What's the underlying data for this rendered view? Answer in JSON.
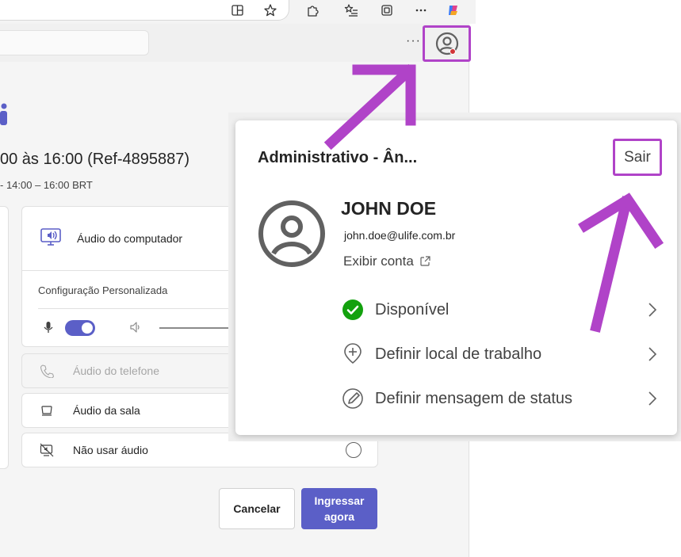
{
  "browser": {
    "icons": [
      "grid-split-icon",
      "favorite-star-icon",
      "extensions-icon",
      "favorites-list-icon",
      "collections-icon",
      "more-icon",
      "copilot-icon"
    ]
  },
  "app": {
    "more_label": "···",
    "meeting": {
      "title": "00 às 16:00 (Ref-4895887)",
      "time": "-  14:00  –  16:00 BRT"
    },
    "audio": {
      "computer_label": "Áudio do computador",
      "config_label": "Configuração Personalizada",
      "mic_on": true
    },
    "options": [
      {
        "label": "Áudio do telefone",
        "disabled": true
      },
      {
        "label": "Áudio da sala",
        "disabled": false
      },
      {
        "label": "Não usar áudio",
        "disabled": false
      }
    ],
    "buttons": {
      "cancel": "Cancelar",
      "join": "Ingressar agora"
    }
  },
  "popup": {
    "org": "Administrativo - Ân...",
    "signout": "Sair",
    "name": "JOHN DOE",
    "email": "john.doe@ulife.com.br",
    "view_account": "Exibir conta",
    "rows": [
      {
        "label": "Disponível",
        "icon": "available-check-icon"
      },
      {
        "label": "Definir local de trabalho",
        "icon": "location-plus-icon"
      },
      {
        "label": "Definir mensagem de status",
        "icon": "pencil-status-icon"
      }
    ]
  },
  "colors": {
    "accent": "#5b5fc7",
    "highlight": "#b043c8",
    "available": "#13a10e",
    "alert_dot": "#d13438"
  }
}
